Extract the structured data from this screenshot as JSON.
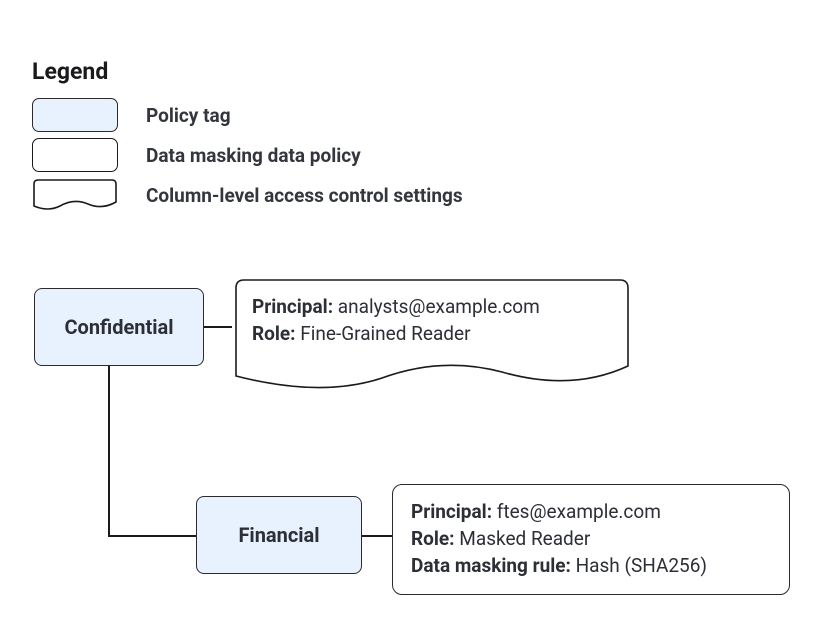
{
  "legend": {
    "title": "Legend",
    "items": [
      {
        "swatch": "tag",
        "label": "Policy tag"
      },
      {
        "swatch": "box",
        "label": "Data masking data policy"
      },
      {
        "swatch": "scroll",
        "label": "Column-level access control settings"
      }
    ]
  },
  "diagram": {
    "nodes": {
      "confidential": {
        "label": "Confidential"
      },
      "financial": {
        "label": "Financial"
      }
    },
    "details": {
      "confidential_acl": {
        "principal_label": "Principal:",
        "principal_value": "analysts@example.com",
        "role_label": "Role:",
        "role_value": "Fine-Grained Reader"
      },
      "financial_policy": {
        "principal_label": "Principal:",
        "principal_value": "ftes@example.com",
        "role_label": "Role:",
        "role_value": "Masked Reader",
        "mask_label": "Data masking rule:",
        "mask_value": "Hash (SHA256)"
      }
    }
  }
}
